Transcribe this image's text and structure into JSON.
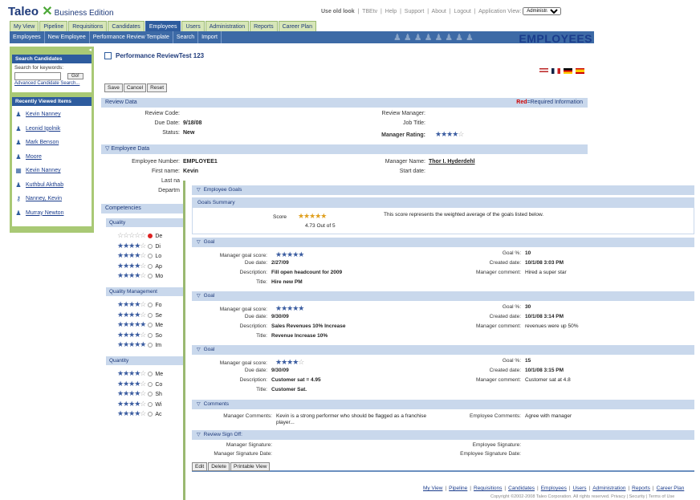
{
  "header": {
    "logo": "Taleo",
    "logo_mark": "✕",
    "edition": "Business Edition",
    "links": [
      "Use old look",
      "TBEtv",
      "Help",
      "Support",
      "About",
      "Logout"
    ],
    "app_view_label": "Application View:",
    "app_view_value": "Administrator"
  },
  "tabs": [
    "My View",
    "Pipeline",
    "Requisitions",
    "Candidates",
    "Employees",
    "Users",
    "Administration",
    "Reports",
    "Career Plan"
  ],
  "active_tab": "Employees",
  "subnav": [
    "Employees",
    "New Employee",
    "Performance Review Template",
    "Search",
    "Import"
  ],
  "banner": "EMPLOYEES",
  "sidebar": {
    "search_header": "Search Candidates",
    "search_label": "Search for keywords:",
    "go": "Go!",
    "advanced": "Advanced Candidate Search...",
    "recent_header": "Recently Viewed Items",
    "recent": [
      "Kevin Nanney",
      "Leonid Igolnik",
      "Mark Benson",
      "Moore",
      "Kevin Nanney",
      "Kuthbul Akthab",
      "Nanney, Kevin",
      "Murray Newton"
    ]
  },
  "page": {
    "title": "Performance ReviewTest 123",
    "buttons": [
      "Save",
      "Cancel",
      "Reset"
    ],
    "review_data": {
      "header": "Review Data",
      "required_red": "Red",
      "required_text": "=Required Information",
      "review_code_label": "Review Code:",
      "due_date_label": "Due Date:",
      "due_date": "9/18/08",
      "status_label": "Status:",
      "status": "New",
      "review_manager_label": "Review Manager:",
      "job_title_label": "Job Title:",
      "manager_rating_label": "Manager Rating:",
      "manager_rating": 4
    },
    "employee_data": {
      "header": "Employee Data",
      "number_label": "Employee Number:",
      "number": "EMPLOYEE1",
      "first_label": "First name:",
      "first": "Kevin",
      "last_label": "Last na",
      "dept_label": "Departm",
      "manager_label": "Manager Name:",
      "manager": "Thor I. Hyderdehl",
      "start_label": "Start date:"
    },
    "competencies": {
      "header": "Competencies",
      "groups": [
        {
          "name": "Quality",
          "rows": [
            {
              "stars": 0,
              "label": "De"
            },
            {
              "stars": 4,
              "label": "Di"
            },
            {
              "stars": 4,
              "label": "Lo"
            },
            {
              "stars": 4,
              "label": "Ap"
            },
            {
              "stars": 4,
              "label": "Mo"
            }
          ]
        },
        {
          "name": "Quality Management",
          "rows": [
            {
              "stars": 4,
              "label": "Fo"
            },
            {
              "stars": 4,
              "label": "Se"
            },
            {
              "stars": 5,
              "label": "Me"
            },
            {
              "stars": 4,
              "label": "So"
            },
            {
              "stars": 5,
              "label": "Im"
            }
          ]
        },
        {
          "name": "Quantity",
          "rows": [
            {
              "stars": 4,
              "label": "Me"
            },
            {
              "stars": 4,
              "label": "Co"
            },
            {
              "stars": 4,
              "label": "Sh"
            },
            {
              "stars": 4,
              "label": "Wi"
            },
            {
              "stars": 4,
              "label": "Ac"
            }
          ]
        }
      ]
    }
  },
  "goals_window": {
    "header": "Employee Goals",
    "summary_header": "Goals Summary",
    "score_label": "Score",
    "score_stars": 4.73,
    "score_text": "4.73 Out of 5",
    "score_desc": "This score represents the weighted average of the goals listed below.",
    "goal_header": "Goal",
    "goals": [
      {
        "mgr_score": 5,
        "due": "2/27/09",
        "desc": "Fill open headcount for 2009",
        "title": "Hire new PM",
        "pct": "10",
        "created": "10/1/08 3:03 PM",
        "comment": "Hired a super star"
      },
      {
        "mgr_score": 5,
        "due": "9/30/09",
        "desc": "Sales Revenues 10% Increase",
        "title": "Revenue Increase 10%",
        "pct": "30",
        "created": "10/1/08 3:14 PM",
        "comment": "revenues were up 50%"
      },
      {
        "mgr_score": 4,
        "due": "9/30/09",
        "desc": "Customer sat = 4.95",
        "title": "Customer Sat.",
        "pct": "15",
        "created": "10/1/08 3:15 PM",
        "comment": "Customer sat at 4.8"
      }
    ],
    "labels": {
      "mgr_score": "Manager goal score:",
      "due": "Due date:",
      "desc": "Description:",
      "title": "Title:",
      "pct": "Goal %:",
      "created": "Created date:",
      "comment": "Manager comment:"
    },
    "comments": {
      "header": "Comments",
      "mgr_label": "Manager Comments:",
      "mgr_text": "Kevin is a strong performer who should be flagged as a franchise player...",
      "emp_label": "Employee Comments:",
      "emp_text": "Agree with manager"
    },
    "signoff": {
      "header": "Review Sign Off:",
      "mgr_sig": "Manager Signature:",
      "mgr_sig_date": "Manager Signature Date:",
      "emp_sig": "Employee Signature:",
      "emp_sig_date": "Employee Signature Date:"
    },
    "buttons": [
      "Edit",
      "Delete",
      "Printable View"
    ],
    "footer_links": [
      "My View",
      "Pipeline",
      "Requisitions",
      "Candidates",
      "Employees",
      "Users",
      "Administration",
      "Reports",
      "Career Plan"
    ],
    "copyright": "Copyright ©2002-2008 Taleo Corporation. All rights reserved. Privacy | Security | Terms of Use"
  },
  "colors": {
    "brand": "#1e3a7a",
    "accent": "#2e5c9e",
    "green": "#a9c975",
    "section": "#c9d8ec"
  }
}
